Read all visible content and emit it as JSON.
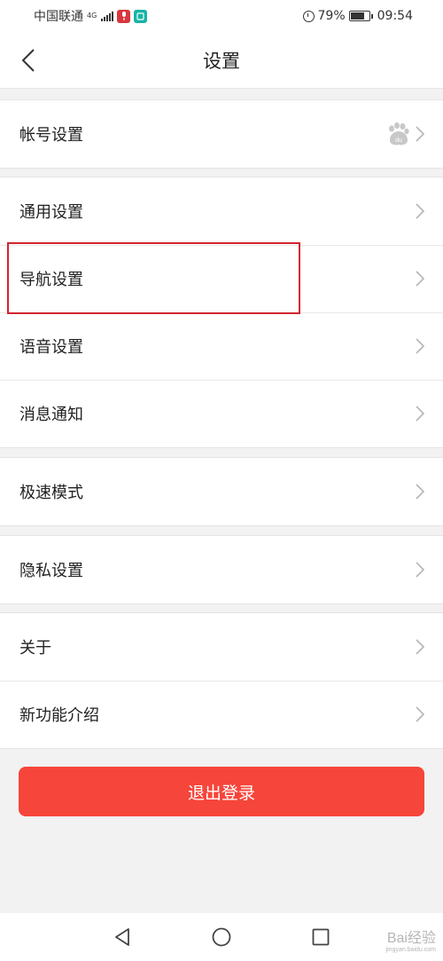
{
  "status_bar": {
    "carrier": "中国联通",
    "network": "4G",
    "battery": "79%",
    "time": "09:54"
  },
  "header": {
    "title": "设置"
  },
  "groups": [
    {
      "items": [
        {
          "label": "帐号设置",
          "icon": "baidu-paw-icon"
        }
      ]
    },
    {
      "items": [
        {
          "label": "通用设置"
        },
        {
          "label": "导航设置"
        },
        {
          "label": "语音设置"
        },
        {
          "label": "消息通知"
        }
      ]
    },
    {
      "items": [
        {
          "label": "极速模式"
        }
      ]
    },
    {
      "items": [
        {
          "label": "隐私设置"
        }
      ]
    },
    {
      "items": [
        {
          "label": "关于"
        },
        {
          "label": "新功能介绍"
        }
      ]
    }
  ],
  "logout_label": "退出登录",
  "watermark": {
    "text": "Bai经验",
    "sub": "jingyan.baidu.com"
  },
  "colors": {
    "accent": "#f6453a",
    "highlight": "#d0252f"
  }
}
